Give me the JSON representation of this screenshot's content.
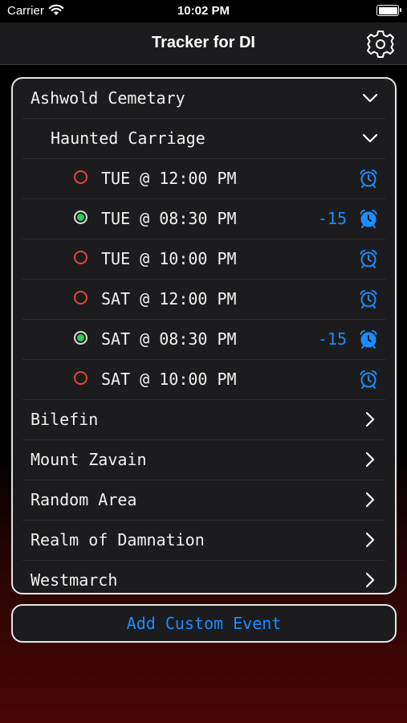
{
  "status": {
    "carrier": "Carrier",
    "time": "10:02 PM"
  },
  "nav": {
    "title": "Tracker for DI",
    "settings_icon": "gear-icon"
  },
  "expanded": {
    "label": "Ashwold Cemetary",
    "sub": {
      "label": "Haunted Carriage",
      "events": [
        {
          "time": "TUE @ 12:00 PM",
          "done": false,
          "offset": ""
        },
        {
          "time": "TUE @ 08:30 PM",
          "done": true,
          "offset": "-15"
        },
        {
          "time": "TUE @ 10:00 PM",
          "done": false,
          "offset": ""
        },
        {
          "time": "SAT @ 12:00 PM",
          "done": false,
          "offset": ""
        },
        {
          "time": "SAT @ 08:30 PM",
          "done": true,
          "offset": "-15"
        },
        {
          "time": "SAT @ 10:00 PM",
          "done": false,
          "offset": ""
        }
      ]
    }
  },
  "collapsed": [
    "Bilefin",
    "Mount Zavain",
    "Random Area",
    "Realm of Damnation",
    "Westmarch"
  ],
  "add_button": "Add Custom Event",
  "colors": {
    "accent": "#1d8cff",
    "pending": "#e0453c",
    "done": "#34c759"
  }
}
